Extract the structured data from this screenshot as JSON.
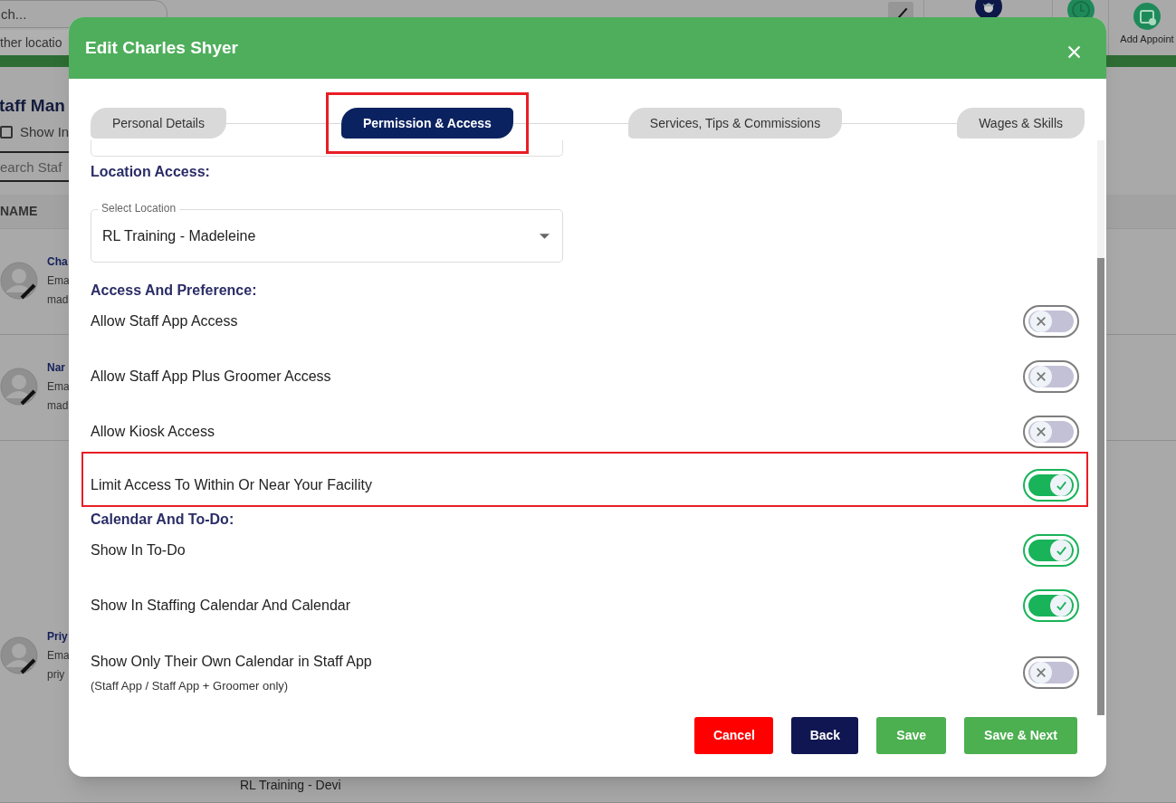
{
  "page": {
    "search": {
      "placeholder": "ch..."
    },
    "location_field": "ther locatio",
    "toolbar": [
      {
        "kind": "edit"
      },
      {
        "kind": "avatar"
      },
      {
        "kind": "clock"
      },
      {
        "kind": "calendar",
        "label": "Add Appoint"
      }
    ],
    "title": "taff Man",
    "show_inactive": {
      "label": "Show In",
      "checked": false
    },
    "search_staff": {
      "placeholder": "earch Staf"
    },
    "table": {
      "columns": [
        "NAME"
      ],
      "rows": [
        {
          "name": "Cha",
          "line_2": "Ema",
          "line_3": "mad"
        },
        {
          "name": "Nar",
          "line_2": "Ema",
          "line_3": "mad"
        },
        {
          "name": "Priy",
          "line_2": "Ema",
          "line_3": "priy",
          "locations": [
            "RL Training - Devi"
          ]
        }
      ]
    }
  },
  "modal": {
    "title": "Edit Charles Shyer",
    "tabs": [
      {
        "label": "Personal Details",
        "selected": false,
        "highlighted": false
      },
      {
        "label": "Permission & Access",
        "selected": true,
        "highlighted": true
      },
      {
        "label": "Services, Tips & Commissions",
        "selected": false,
        "highlighted": false
      },
      {
        "label": "Wages & Skills",
        "selected": false,
        "highlighted": false
      }
    ],
    "sections": [
      {
        "kind": "select",
        "heading": "Location Access:",
        "field": {
          "label": "Select Location",
          "value": "RL Training - Madeleine"
        }
      },
      {
        "kind": "toggles",
        "heading": "Access And Preference:",
        "items": [
          {
            "label": "Allow Staff App Access",
            "on": false,
            "highlighted": false
          },
          {
            "label": "Allow Staff App Plus Groomer Access",
            "on": false,
            "highlighted": false
          },
          {
            "label": "Allow Kiosk Access",
            "on": false,
            "highlighted": false
          },
          {
            "label": "Limit Access To Within Or Near Your Facility",
            "on": true,
            "highlighted": true
          }
        ]
      },
      {
        "kind": "toggles",
        "heading": "Calendar And To-Do:",
        "items": [
          {
            "label": "Show In To-Do",
            "on": true,
            "highlighted": false
          },
          {
            "label": "Show In Staffing Calendar And Calendar",
            "on": true,
            "highlighted": false
          },
          {
            "label": "Show Only Their Own Calendar in Staff App",
            "note": "(Staff App / Staff App + Groomer only)",
            "on": false,
            "highlighted": false
          }
        ]
      }
    ],
    "buttons": [
      {
        "kind": "cancel",
        "label": "Cancel"
      },
      {
        "kind": "back",
        "label": "Back"
      },
      {
        "kind": "save",
        "label": "Save"
      },
      {
        "kind": "save",
        "label": "Save & Next"
      }
    ]
  }
}
